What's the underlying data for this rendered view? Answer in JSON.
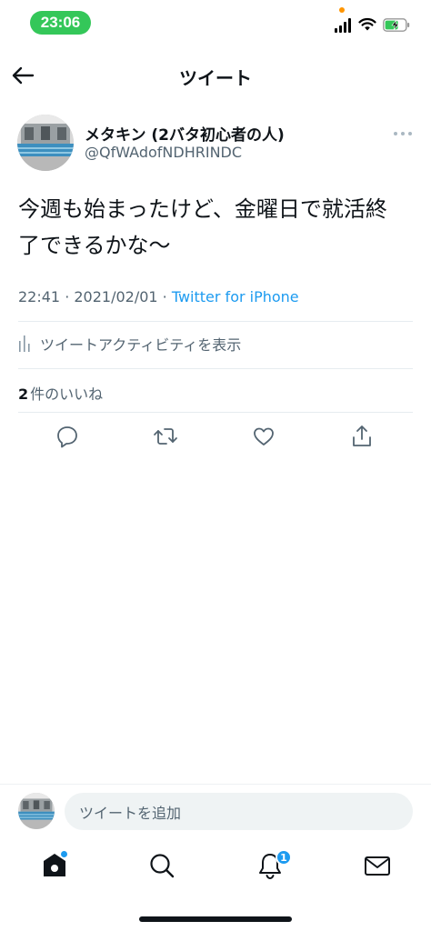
{
  "status_bar": {
    "time": "23:06"
  },
  "header": {
    "title": "ツイート"
  },
  "tweet": {
    "author_name": "メタキン (2バタ初心者の人)",
    "author_handle": "@QfWAdofNDHRINDC",
    "text_line1": "今週も始まったけど、金曜日で就活終",
    "text_line2": "了できるかな〜",
    "timestamp": "22:41 · 2021/02/01 · ",
    "source": "Twitter for iPhone",
    "activity_label": "ツイートアクティビティを表示",
    "likes_count": "2",
    "likes_label": "件のいいね"
  },
  "reply": {
    "placeholder": "ツイートを追加"
  },
  "tabbar": {
    "notifications_badge": "1"
  },
  "colors": {
    "accent": "#1d9bf0",
    "status_green": "#34c759"
  }
}
